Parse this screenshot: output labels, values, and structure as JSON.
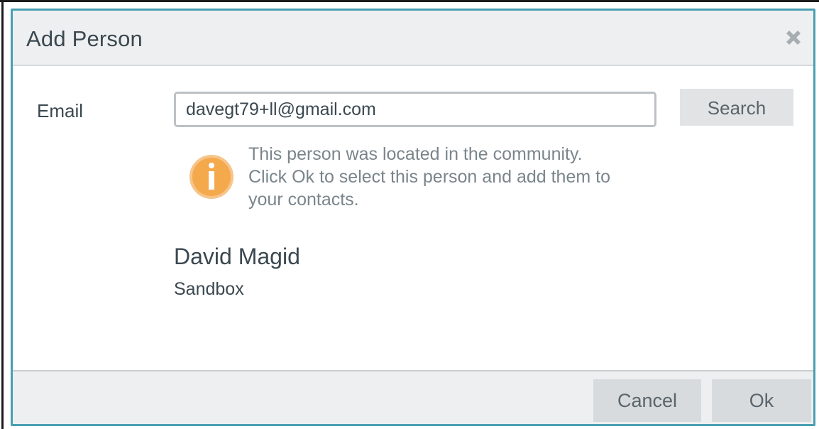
{
  "dialog": {
    "title": "Add Person",
    "close_icon": "close-x-icon"
  },
  "form": {
    "email_label": "Email",
    "email_value": "davegt79+ll@gmail.com",
    "search_label": "Search"
  },
  "info": {
    "icon": "info-icon",
    "icon_color": "#f5a94d",
    "line1": "This person was located in the community.",
    "line2": "Click Ok to select this person and add them to",
    "line3": "your contacts."
  },
  "result": {
    "name": "David Magid",
    "organization": "Sandbox"
  },
  "footer": {
    "cancel_label": "Cancel",
    "ok_label": "Ok"
  },
  "colors": {
    "dialog_border": "#4a9fb2",
    "header_bg": "#eeeff0",
    "text": "#3b4850",
    "muted_text": "#7a858b",
    "button_bg": "#d8dbdd"
  }
}
